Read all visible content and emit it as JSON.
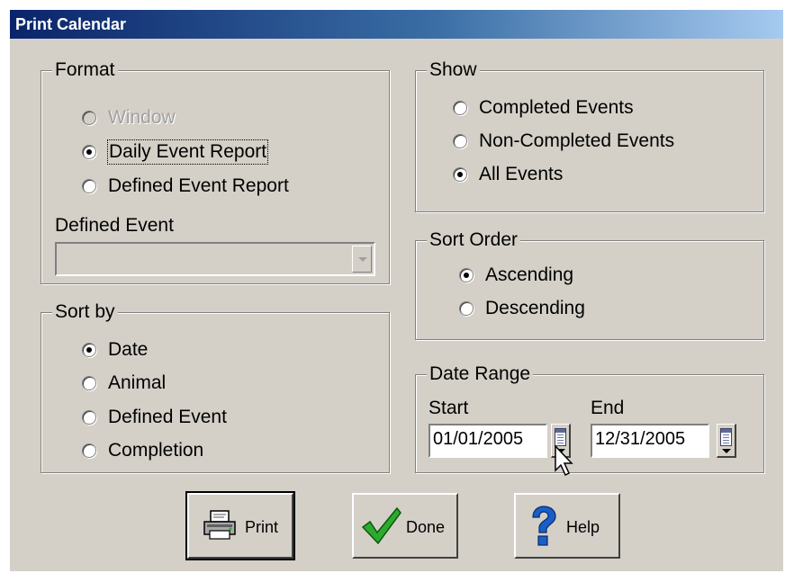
{
  "window": {
    "title": "Print Calendar"
  },
  "format": {
    "label": "Format",
    "options": [
      {
        "label": "Window",
        "checked": false,
        "disabled": true
      },
      {
        "label": "Daily Event Report",
        "checked": true,
        "disabled": false
      },
      {
        "label": "Defined Event Report",
        "checked": false,
        "disabled": false
      }
    ],
    "defined_event_label": "Defined Event",
    "defined_event_value": ""
  },
  "sort_by": {
    "label": "Sort by",
    "options": [
      {
        "label": "Date",
        "checked": true
      },
      {
        "label": "Animal",
        "checked": false
      },
      {
        "label": "Defined Event",
        "checked": false
      },
      {
        "label": "Completion",
        "checked": false
      }
    ]
  },
  "show": {
    "label": "Show",
    "options": [
      {
        "label": "Completed Events",
        "checked": false
      },
      {
        "label": "Non-Completed Events",
        "checked": false
      },
      {
        "label": "All Events",
        "checked": true
      }
    ]
  },
  "sort_order": {
    "label": "Sort Order",
    "options": [
      {
        "label": "Ascending",
        "checked": true
      },
      {
        "label": "Descending",
        "checked": false
      }
    ]
  },
  "date_range": {
    "label": "Date Range",
    "start_label": "Start",
    "start_value": "01/01/2005",
    "end_label": "End",
    "end_value": "12/31/2005"
  },
  "buttons": {
    "print": {
      "label": "Print",
      "icon": "printer-icon"
    },
    "done": {
      "label": "Done",
      "icon": "checkmark-icon"
    },
    "help": {
      "label": "Help",
      "icon": "question-mark-icon"
    }
  },
  "colors": {
    "dialog_bg": "#d4d0c8",
    "title_gradient_start": "#0a246a",
    "title_gradient_end": "#a6caf0",
    "check_green": "#2eaa2e",
    "help_blue": "#1a5ec8"
  }
}
